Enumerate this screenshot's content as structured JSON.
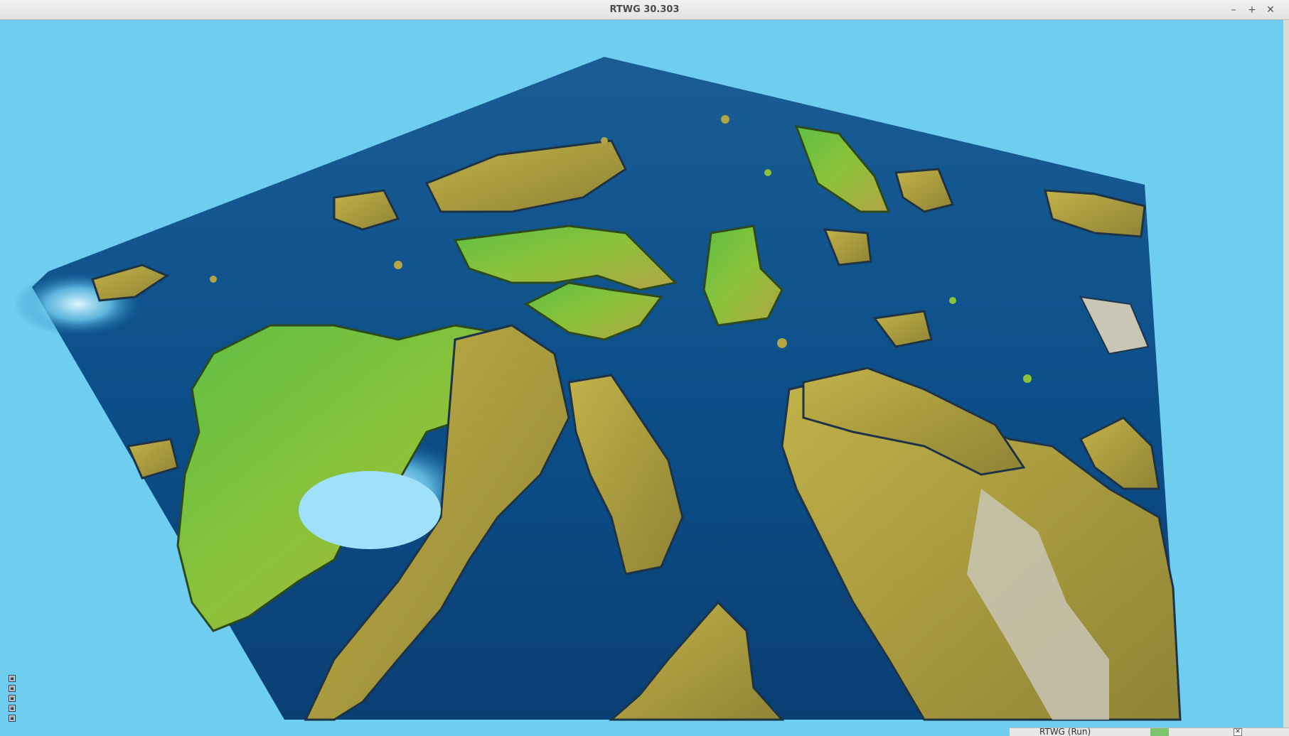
{
  "window": {
    "title": "RTWG 30.303",
    "controls": {
      "minimize": "–",
      "maximize": "+",
      "close": "✕"
    }
  },
  "view": {
    "sky_color": "#6fcdef",
    "ocean_color": "#0b4f8f",
    "land_colors": [
      "#7fc13a",
      "#b6a843",
      "#c9c6b5"
    ]
  },
  "mini_buttons": [
    "▣",
    "▣",
    "▣",
    "▣",
    "▣"
  ],
  "taskbar": {
    "label": "RTWG (Run)",
    "close_glyph": "✕"
  }
}
